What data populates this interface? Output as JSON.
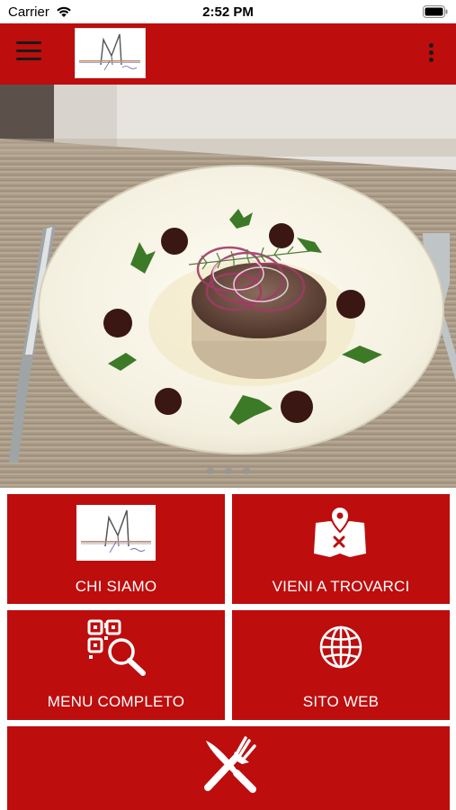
{
  "status_bar": {
    "carrier": "Carrier",
    "time": "2:52 PM"
  },
  "app_bar": {
    "background": "#bd0d0d",
    "menu_icon": "hamburger-icon",
    "logo": "restaurant-logo",
    "more_icon": "more-vertical-icon"
  },
  "hero": {
    "image": "plated-dish-photo",
    "pagination": {
      "count": 3,
      "active": 0
    }
  },
  "tiles": [
    {
      "label": "CHI SIAMO",
      "icon": "restaurant-logo"
    },
    {
      "label": "VIENI A TROVARCI",
      "icon": "map-pin-icon"
    },
    {
      "label": "MENU COMPLETO",
      "icon": "qr-search-icon"
    },
    {
      "label": "SITO WEB",
      "icon": "globe-icon"
    },
    {
      "label": "",
      "icon": "cutlery-icon"
    }
  ],
  "colors": {
    "accent": "#bd0d0d",
    "icon": "#ffffff"
  }
}
